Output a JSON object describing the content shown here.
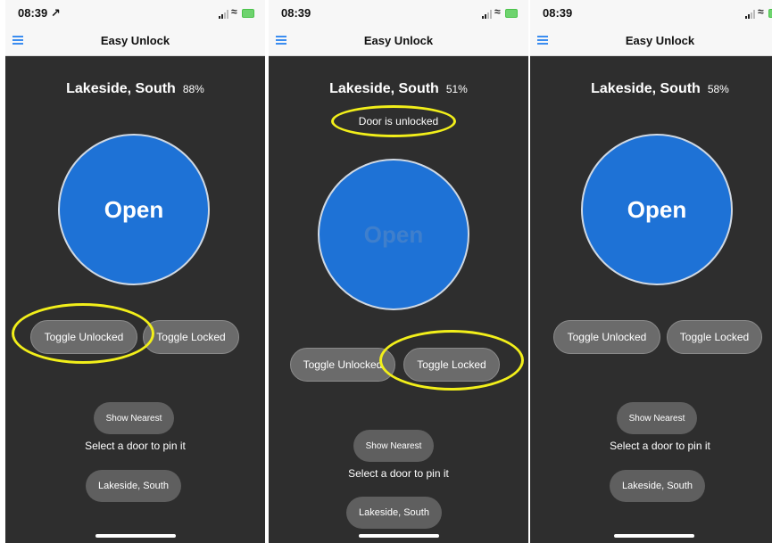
{
  "app": {
    "title": "Easy Unlock",
    "menu_icon": "hamburger-menu-icon",
    "accent_color": "#1e72d6",
    "highlight_color": "#f2ef1a"
  },
  "screens": [
    {
      "time": "08:39",
      "time_suffix": "↗",
      "door_name": "Lakeside, South",
      "battery": "88%",
      "status": "",
      "open_label": "Open",
      "toggle_unlocked": "Toggle Unlocked",
      "toggle_locked": "Toggle Locked",
      "show_nearest": "Show Nearest",
      "select_hint": "Select a door to pin it",
      "pinned_door": "Lakeside, South"
    },
    {
      "time": "08:39",
      "time_suffix": "",
      "door_name": "Lakeside, South",
      "battery": "51%",
      "status": "Door is unlocked",
      "open_label": "Open",
      "toggle_unlocked": "Toggle Unlocked",
      "toggle_locked": "Toggle Locked",
      "show_nearest": "Show Nearest",
      "select_hint": "Select a door to pin it",
      "pinned_door": "Lakeside, South"
    },
    {
      "time": "08:39",
      "time_suffix": "",
      "door_name": "Lakeside, South",
      "battery": "58%",
      "status": "",
      "open_label": "Open",
      "toggle_unlocked": "Toggle Unlocked",
      "toggle_locked": "Toggle Locked",
      "show_nearest": "Show Nearest",
      "select_hint": "Select a door to pin it",
      "pinned_door": "Lakeside, South"
    }
  ]
}
